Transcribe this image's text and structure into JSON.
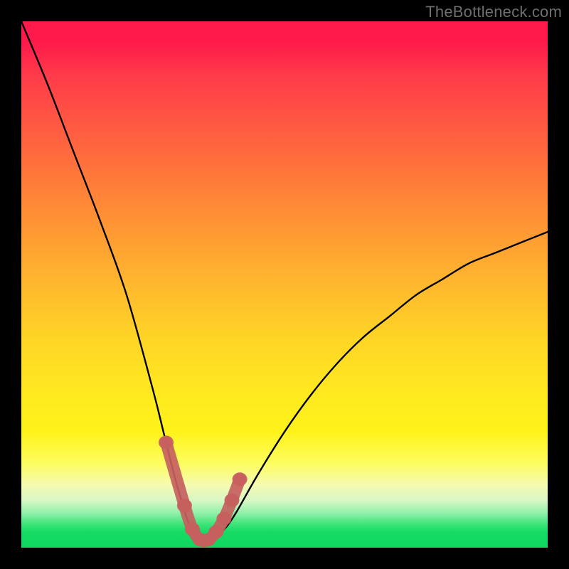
{
  "watermark": "TheBottleneck.com",
  "colors": {
    "background": "#000000",
    "gradient_top": "#ff1a4b",
    "gradient_mid": "#ffe820",
    "gradient_bottom": "#0fd760",
    "curve": "#000000",
    "markers": "#c6605f"
  },
  "chart_data": {
    "type": "line",
    "title": "",
    "xlabel": "",
    "ylabel": "",
    "xlim": [
      0,
      100
    ],
    "ylim": [
      0,
      100
    ],
    "grid": false,
    "legend": false,
    "series": [
      {
        "name": "bottleneck-curve",
        "x": [
          0,
          5,
          10,
          15,
          20,
          25,
          27,
          29,
          31,
          32,
          33,
          34,
          35,
          36,
          37,
          39,
          41,
          45,
          50,
          55,
          60,
          65,
          70,
          75,
          80,
          85,
          90,
          95,
          100
        ],
        "values": [
          100,
          88,
          75,
          62,
          48,
          30,
          22,
          14,
          7,
          4,
          2,
          1,
          1,
          1,
          2,
          4,
          7,
          14,
          22,
          29,
          35,
          40,
          44,
          48,
          51,
          54,
          56,
          58,
          60
        ]
      }
    ],
    "markers": {
      "name": "highlight-points",
      "shape": "rounded-dot",
      "x": [
        27.5,
        31.0,
        32.5,
        34.0,
        35.5,
        37.0,
        38.5,
        40.0,
        41.5
      ],
      "values": [
        20.0,
        8.0,
        3.5,
        1.5,
        1.5,
        3.0,
        5.5,
        9.0,
        13.0
      ]
    },
    "annotations": []
  }
}
